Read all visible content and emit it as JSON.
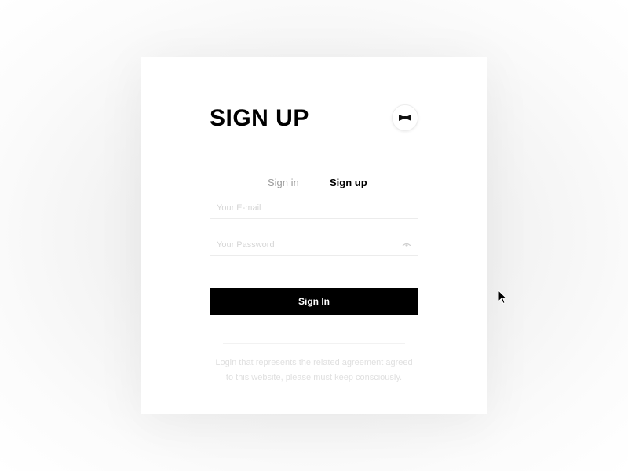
{
  "form": {
    "title": "SIGN UP",
    "brand_icon": "bow-tie-icon",
    "tabs": [
      {
        "label": "Sign in",
        "active": false
      },
      {
        "label": "Sign up",
        "active": true
      }
    ],
    "email": {
      "placeholder": "Your E-mail",
      "value": ""
    },
    "password": {
      "placeholder": "Your Password",
      "value": "",
      "toggle_icon": "eye-icon"
    },
    "submit_label": "Sign In",
    "note_lines": [
      "Login that represents the related agreement agreed",
      "to this website, please must keep consciously."
    ]
  },
  "colors": {
    "accent": "#000000",
    "background": "#ffffff",
    "muted_text": "#9b9b9b",
    "faded_text": "#e0e0e0"
  }
}
